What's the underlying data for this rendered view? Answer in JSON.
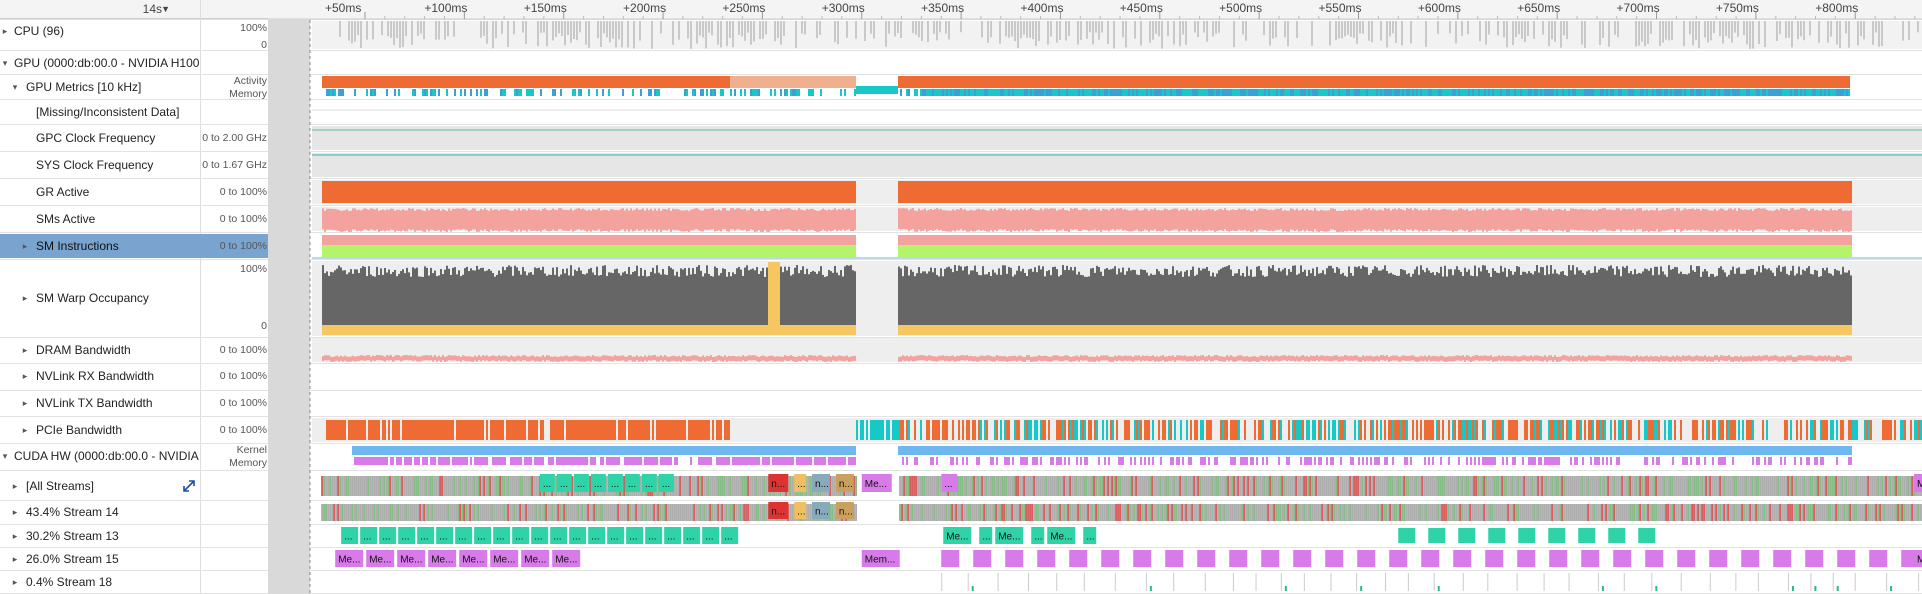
{
  "header": {
    "range_label": "14s",
    "range_caret": "▼",
    "offset_label": "ms"
  },
  "ruler": [
    {
      "label": "+50ms",
      "t": 50
    },
    {
      "label": "+100ms",
      "t": 100
    },
    {
      "label": "+150ms",
      "t": 150
    },
    {
      "label": "+200ms",
      "t": 200
    },
    {
      "label": "+250ms",
      "t": 250
    },
    {
      "label": "+300ms",
      "t": 300
    },
    {
      "label": "+350ms",
      "t": 350
    },
    {
      "label": "+400ms",
      "t": 400
    },
    {
      "label": "+450ms",
      "t": 450
    },
    {
      "label": "+500ms",
      "t": 500
    },
    {
      "label": "+550ms",
      "t": 550
    },
    {
      "label": "+600ms",
      "t": 600
    },
    {
      "label": "+650ms",
      "t": 650
    },
    {
      "label": "+700ms",
      "t": 700
    },
    {
      "label": "+750ms",
      "t": 750
    },
    {
      "label": "+800ms",
      "t": 800
    }
  ],
  "rows": {
    "cpu": {
      "label": "CPU (96)",
      "scale_top": "100%",
      "scale_bottom": "0",
      "toggle": "▸"
    },
    "gpu": {
      "label": "GPU (0000:db:00.0 - NVIDIA H100",
      "toggle": "▾"
    },
    "gpu_metrics": {
      "label": "GPU Metrics [10 kHz]",
      "scale_top": "Activity",
      "scale_bottom": "Memory",
      "toggle": "▾"
    },
    "missing": {
      "label": "[Missing/Inconsistent Data]"
    },
    "gpc": {
      "label": "GPC Clock Frequency",
      "scale": "0 to 2.00 GHz"
    },
    "sys": {
      "label": "SYS Clock Frequency",
      "scale": "0 to 1.67 GHz"
    },
    "gr": {
      "label": "GR Active",
      "scale": "0 to 100%"
    },
    "sms": {
      "label": "SMs Active",
      "scale": "0 to 100%"
    },
    "smi": {
      "label": "SM Instructions",
      "scale": "0 to 100%",
      "toggle": "▸"
    },
    "warp": {
      "label": "SM Warp Occupancy",
      "scale_top": "100%",
      "scale_bottom": "0",
      "toggle": "▸"
    },
    "dram": {
      "label": "DRAM Bandwidth",
      "scale": "0 to 100%",
      "toggle": "▸"
    },
    "nvrx": {
      "label": "NVLink RX Bandwidth",
      "scale": "0 to 100%",
      "toggle": "▸"
    },
    "nvtx": {
      "label": "NVLink TX Bandwidth",
      "scale": "0 to 100%",
      "toggle": "▸"
    },
    "pcie": {
      "label": "PCIe Bandwidth",
      "scale": "0 to 100%",
      "toggle": "▸"
    },
    "cudahw": {
      "label": "CUDA HW (0000:db:00.0 - NVIDIA",
      "scale_top": "Kernel",
      "scale_bottom": "Memory",
      "toggle": "▾"
    },
    "allstreams": {
      "label": "[All Streams]",
      "toggle": "▸",
      "expand_icon": "expand-arrows"
    },
    "s14": {
      "label": "43.4% Stream 14",
      "toggle": "▸"
    },
    "s13": {
      "label": "30.2% Stream 13",
      "toggle": "▸"
    },
    "s15": {
      "label": "26.0% Stream 15",
      "toggle": "▸"
    },
    "s18": {
      "label": "0.4% Stream 18",
      "toggle": "▸"
    }
  },
  "timeline_labels": {
    "kernel_short": "...",
    "mem_label": "Me...",
    "mem_long": "Mem...",
    "n_label": "n...",
    "mem_short": "M"
  },
  "colors": {
    "orange": "#ee6b34",
    "cyan": "#17c8c8",
    "salmon": "#f4a29e",
    "green": "#b4f46a",
    "gray": "#666666",
    "yellow": "#f6c660",
    "kernel_blue": "#6fb8ef",
    "mem_purple": "#d77be8",
    "teal_block": "#2ed4a8",
    "selected": "#78a4cf"
  }
}
